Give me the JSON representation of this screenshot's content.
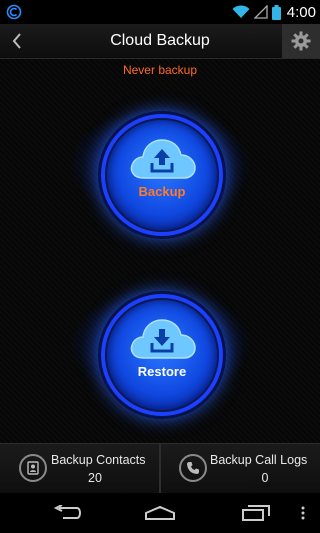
{
  "status_bar": {
    "time": "4:00"
  },
  "header": {
    "title": "Cloud Backup",
    "back_icon": "chevron-left-icon",
    "settings_icon": "gear-icon"
  },
  "main": {
    "status_text": "Never backup",
    "backup_button": {
      "label": "Backup",
      "icon": "cloud-upload-icon"
    },
    "restore_button": {
      "label": "Restore",
      "icon": "cloud-download-icon"
    }
  },
  "bottom": {
    "contacts": {
      "label": "Backup Contacts",
      "count": "20",
      "icon": "contacts-icon"
    },
    "call_logs": {
      "label": "Backup Call Logs",
      "count": "0",
      "icon": "phone-icon"
    }
  },
  "colors": {
    "accent": "#ff6a2a",
    "glow": "#1d40ff"
  }
}
